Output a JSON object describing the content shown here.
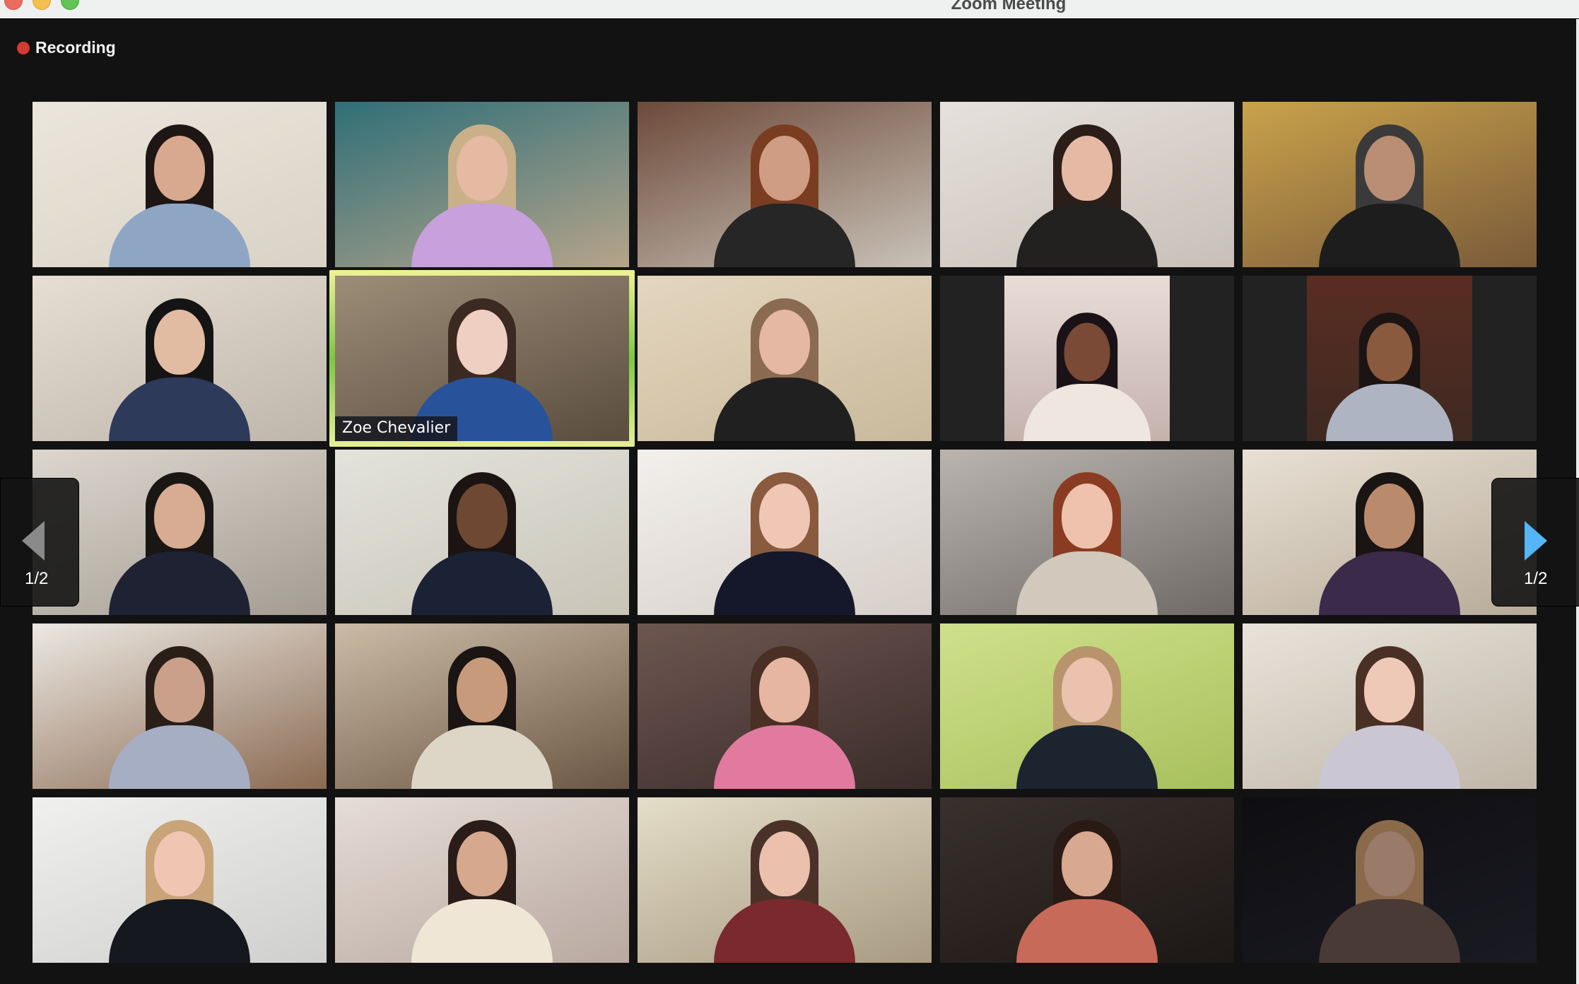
{
  "window": {
    "title": "Zoom Meeting"
  },
  "recording": {
    "label": "Recording",
    "color": "#d23a32"
  },
  "pagination": {
    "current_page": 1,
    "total_pages": 2,
    "label": "1/2"
  },
  "active_speaker": {
    "name": "Zoe Chevalier",
    "highlight_color": "#d9e98a"
  },
  "gallery": {
    "columns": 5,
    "rows": 5,
    "participants": [
      {
        "id": 1,
        "bg": [
          "#ebe6dc",
          "#d9d2c6"
        ],
        "hair": "#1e1614",
        "skin": "#d8a98e",
        "top": "#8ea6c4",
        "video": true
      },
      {
        "id": 2,
        "bg": [
          "#2f6f78",
          "#b6a48a"
        ],
        "hair": "#c9b089",
        "skin": "#e5b9a2",
        "top": "#c7a0dc",
        "video": true
      },
      {
        "id": 3,
        "bg": [
          "#6d4a3a",
          "#c9c2b8"
        ],
        "hair": "#7b3d22",
        "skin": "#cf9d84",
        "top": "#262626",
        "video": true
      },
      {
        "id": 4,
        "bg": [
          "#e6e1dc",
          "#c8c0b8"
        ],
        "hair": "#2b1d18",
        "skin": "#e6b9a4",
        "top": "#232020",
        "video": true
      },
      {
        "id": 5,
        "bg": [
          "#c9a24a",
          "#7a5a3a"
        ],
        "hair": "#3a3a3a",
        "skin": "#b98e74",
        "top": "#1d1d1d",
        "video": true
      },
      {
        "id": 6,
        "bg": [
          "#e7ded3",
          "#bfb6ab"
        ],
        "hair": "#141414",
        "skin": "#e2bba3",
        "top": "#2d3a5a",
        "video": true
      },
      {
        "id": 7,
        "bg": [
          "#9c8d78",
          "#5a4c3e"
        ],
        "hair": "#3b2a22",
        "skin": "#efcfc2",
        "top": "#28539a",
        "video": true,
        "active": true
      },
      {
        "id": 8,
        "bg": [
          "#e4d6bf",
          "#c9b99c"
        ],
        "hair": "#8a6b52",
        "skin": "#e4b8a3",
        "top": "#202020",
        "video": true
      },
      {
        "id": 9,
        "bg": [
          "#e9dcd6",
          "#c4b2ad"
        ],
        "hair": "#1a1216",
        "skin": "#7a4a36",
        "top": "#efe6e0",
        "video": false
      },
      {
        "id": 10,
        "bg": [
          "#5a2c22",
          "#3e2a22"
        ],
        "hair": "#1b1412",
        "skin": "#8a5a3e",
        "top": "#aeb4c2",
        "video": false
      },
      {
        "id": 11,
        "bg": [
          "#dcd6ce",
          "#a49c92"
        ],
        "hair": "#1a1614",
        "skin": "#d7ac92",
        "top": "#1e2233",
        "video": true
      },
      {
        "id": 12,
        "bg": [
          "#e3e3dc",
          "#c9c4b8"
        ],
        "hair": "#1b1412",
        "skin": "#6f4834",
        "top": "#1b2236",
        "video": true
      },
      {
        "id": 13,
        "bg": [
          "#f2efec",
          "#d6cfc9"
        ],
        "hair": "#8a5a3e",
        "skin": "#f0c6b4",
        "top": "#14182a",
        "video": true
      },
      {
        "id": 14,
        "bg": [
          "#b9b4ae",
          "#6f6a66"
        ],
        "hair": "#8a3c22",
        "skin": "#eec2ad",
        "top": "#d2c8bc",
        "video": true
      },
      {
        "id": 15,
        "bg": [
          "#e8e0d4",
          "#b7aa98"
        ],
        "hair": "#1a1412",
        "skin": "#b98a6c",
        "top": "#3b2a4a",
        "video": true
      },
      {
        "id": 16,
        "bg": [
          "#ece8e2",
          "#8a6a52"
        ],
        "hair": "#2a1e18",
        "skin": "#caa08a",
        "top": "#a6aec4",
        "video": true
      },
      {
        "id": 17,
        "bg": [
          "#cbbca6",
          "#6a5644"
        ],
        "hair": "#1a1412",
        "skin": "#c79a7c",
        "top": "#ddd6c6",
        "video": true
      },
      {
        "id": 18,
        "bg": [
          "#6e5650",
          "#3a2c2a"
        ],
        "hair": "#4a3024",
        "skin": "#e6b6a2",
        "top": "#e27aa0",
        "video": true
      },
      {
        "id": 19,
        "bg": [
          "#cfe08a",
          "#a8c05e"
        ],
        "hair": "#b8946c",
        "skin": "#ebc2ae",
        "top": "#1c2430",
        "video": true
      },
      {
        "id": 20,
        "bg": [
          "#e8e3da",
          "#c0b6a8"
        ],
        "hair": "#4a3024",
        "skin": "#efc9b8",
        "top": "#cbc6d4",
        "video": true
      },
      {
        "id": 21,
        "bg": [
          "#f0f0ee",
          "#cfd0ce"
        ],
        "hair": "#c8a478",
        "skin": "#efc6b2",
        "top": "#161820",
        "video": true
      },
      {
        "id": 22,
        "bg": [
          "#e6ddd6",
          "#b8a8a0"
        ],
        "hair": "#2a1c18",
        "skin": "#d6a88e",
        "top": "#f0e6d6",
        "video": true
      },
      {
        "id": 23,
        "bg": [
          "#e4ddc8",
          "#a89a82"
        ],
        "hair": "#4a3228",
        "skin": "#ebc0ac",
        "top": "#7a2a2e",
        "video": true
      },
      {
        "id": 24,
        "bg": [
          "#3a302c",
          "#1c1816"
        ],
        "hair": "#2a1a16",
        "skin": "#d8a890",
        "top": "#c86a5a",
        "video": true
      },
      {
        "id": 25,
        "bg": [
          "#0e0e12",
          "#1a1a22"
        ],
        "hair": "#8a6a4a",
        "skin": "#9a7a68",
        "top": "#4a3a36",
        "video": true
      }
    ]
  }
}
